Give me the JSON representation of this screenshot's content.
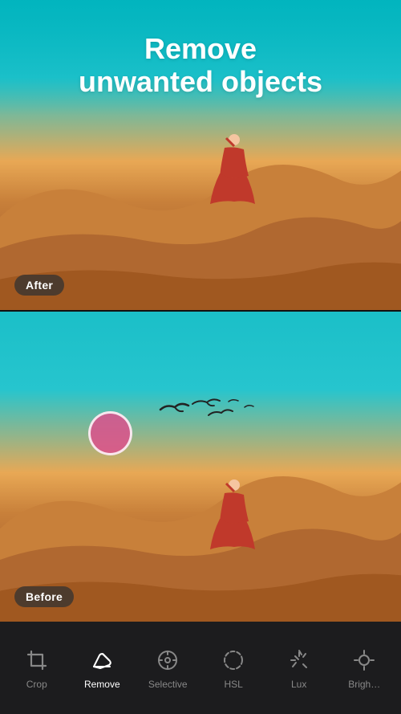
{
  "header": {
    "title_line1": "Remove",
    "title_line2": "unwanted objects"
  },
  "panels": {
    "after_label": "After",
    "before_label": "Before"
  },
  "toolbar": {
    "tools": [
      {
        "id": "crop",
        "label": "Crop",
        "icon": "crop",
        "active": false
      },
      {
        "id": "remove",
        "label": "Remove",
        "icon": "eraser",
        "active": true
      },
      {
        "id": "selective",
        "label": "Selective",
        "icon": "circle-dot",
        "active": false
      },
      {
        "id": "hsl",
        "label": "HSL",
        "icon": "circle-ring",
        "active": false
      },
      {
        "id": "lux",
        "label": "Lux",
        "icon": "sparkle",
        "active": false
      },
      {
        "id": "brightness",
        "label": "Brigh…",
        "icon": "sun",
        "active": false
      }
    ]
  },
  "colors": {
    "sky": "#1bbfc8",
    "sand": "#c8803a",
    "accent": "#ffffff",
    "toolbar_bg": "#1c1c1e",
    "active_tool": "#ffffff",
    "inactive_tool": "#888888",
    "badge_bg": "rgba(50,50,50,0.75)",
    "selection_circle": "rgba(220,80,140,0.85)"
  }
}
